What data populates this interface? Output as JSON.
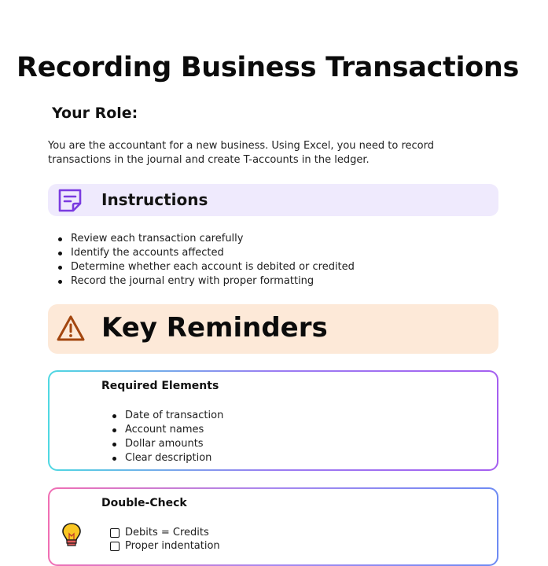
{
  "title": "Recording Business Transactions",
  "role": {
    "heading": "Your Role:",
    "text": "You are the accountant for a new business. Using Excel, you need to record transactions in the journal and create T-accounts in the ledger."
  },
  "instructions": {
    "label": "Instructions",
    "icon": "sticky-note-icon",
    "items": [
      "Review each transaction carefully",
      "Identify the accounts affected",
      "Determine whether each account is debited or credited",
      "Record the journal entry with proper formatting"
    ]
  },
  "key_reminders": {
    "label": "Key Reminders",
    "icon": "warning-icon"
  },
  "required_elements": {
    "title": "Required Elements",
    "items": [
      "Date of transaction",
      "Account names",
      "Dollar amounts",
      "Clear description"
    ]
  },
  "double_check": {
    "title": "Double-Check",
    "icon": "lightbulb-icon",
    "items": [
      "Debits = Credits",
      "Proper indentation"
    ]
  },
  "colors": {
    "instructions_bg": "#efeafd",
    "instructions_icon": "#7a3be0",
    "reminders_bg": "#fde9d8",
    "warning_icon": "#a3460f"
  }
}
